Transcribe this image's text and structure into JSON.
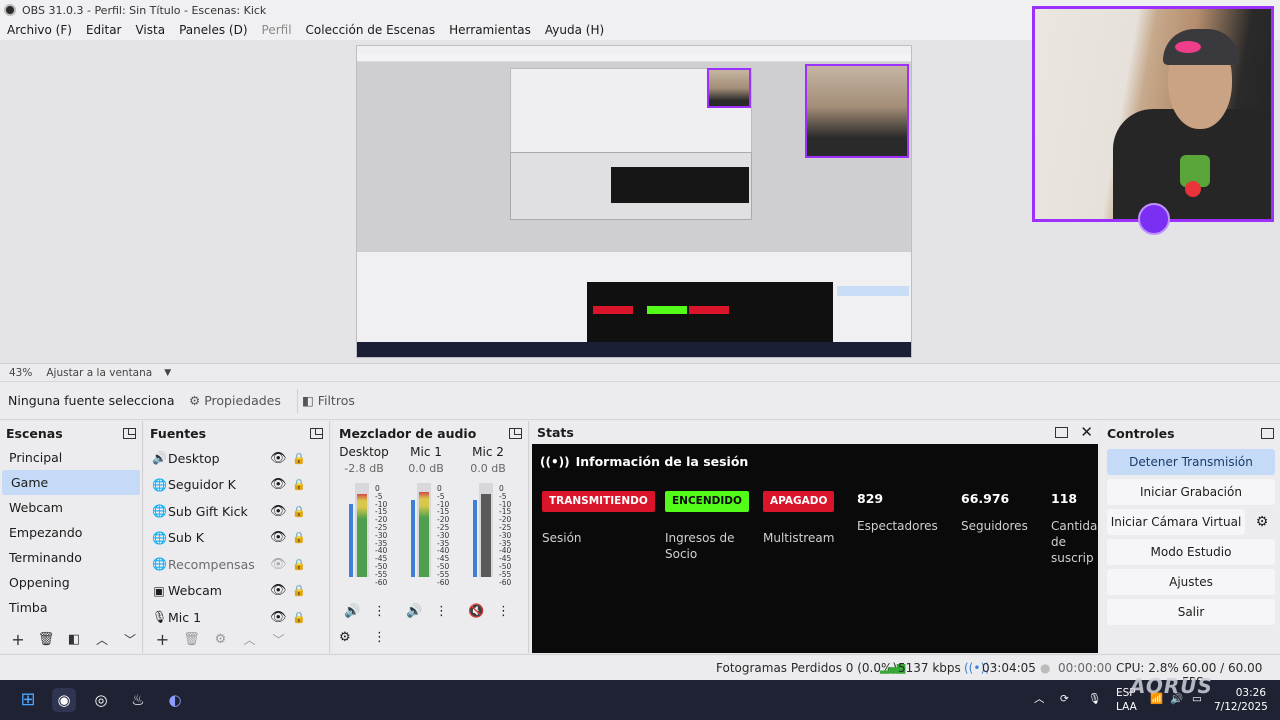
{
  "window": {
    "title": "OBS 31.0.3 - Perfil: Sin Título - Escenas: Kick"
  },
  "menu": [
    {
      "label": "Archivo (F)",
      "enabled": true
    },
    {
      "label": "Editar",
      "enabled": true
    },
    {
      "label": "Vista",
      "enabled": true
    },
    {
      "label": "Paneles (D)",
      "enabled": true
    },
    {
      "label": "Perfil",
      "enabled": false
    },
    {
      "label": "Colección de Escenas",
      "enabled": true
    },
    {
      "label": "Herramientas",
      "enabled": true
    },
    {
      "label": "Ayuda (H)",
      "enabled": true
    }
  ],
  "preview": {
    "zoom": "43%",
    "scale_mode": "Ajustar a la ventana"
  },
  "props_bar": {
    "no_source": "Ninguna fuente selecciona",
    "properties": "Propiedades",
    "filters": "Filtros"
  },
  "scenes": {
    "title": "Escenas",
    "items": [
      "Principal",
      "Game",
      "Webcam",
      "Empezando",
      "Terminando",
      "Oppening",
      "Timba"
    ],
    "selected": "Game"
  },
  "sources": {
    "title": "Fuentes",
    "items": [
      {
        "name": "Desktop",
        "icon": "speaker-icon",
        "visible": true,
        "locked": false
      },
      {
        "name": "Seguidor K",
        "icon": "globe-icon",
        "visible": true,
        "locked": true
      },
      {
        "name": "Sub Gift Kick",
        "icon": "globe-icon",
        "visible": true,
        "locked": true
      },
      {
        "name": "Sub K",
        "icon": "globe-icon",
        "visible": true,
        "locked": true
      },
      {
        "name": "Recompensas",
        "icon": "globe-icon",
        "visible": false,
        "locked": true
      },
      {
        "name": "Webcam",
        "icon": "camera-icon",
        "visible": true,
        "locked": true
      },
      {
        "name": "Mic 1",
        "icon": "microphone-icon",
        "visible": true,
        "locked": true
      }
    ]
  },
  "mixer": {
    "title": "Mezclador de audio",
    "channels": [
      {
        "name": "Desktop",
        "db": "-2.8 dB",
        "level": 0.88,
        "fader": 0.78,
        "muted": false
      },
      {
        "name": "Mic 1",
        "db": "0.0 dB",
        "level": 0.9,
        "fader": 0.82,
        "muted": false
      },
      {
        "name": "Mic 2",
        "db": "0.0 dB",
        "level": 0.88,
        "fader": 0.82,
        "muted": true
      }
    ],
    "scale": [
      "0",
      "-5",
      "-10",
      "-15",
      "-20",
      "-25",
      "-30",
      "-35",
      "-40",
      "-45",
      "-50",
      "-55",
      "-60"
    ]
  },
  "stats": {
    "title": "Stats",
    "session_title": "Información de la sesión",
    "badges": [
      {
        "text": "TRANSMITIENDO",
        "label": "Sesión",
        "color": "#d9142b",
        "text_color": "#ffffff"
      },
      {
        "text": "ENCENDIDO",
        "label": "Ingresos de Socio",
        "color": "#53fc18",
        "text_color": "#0a0a0a"
      },
      {
        "text": "APAGADO",
        "label": "Multistream",
        "color": "#d9142b",
        "text_color": "#ffffff"
      }
    ],
    "numbers": [
      {
        "value": "829",
        "label": "Espectadores"
      },
      {
        "value": "66.976",
        "label": "Seguidores"
      },
      {
        "value": "118",
        "label": "Cantidad de suscrip"
      }
    ]
  },
  "controls": {
    "title": "Controles",
    "buttons": [
      "Detener Transmisión",
      "Iniciar Grabación",
      "Iniciar Cámara Virtual",
      "Modo Estudio",
      "Ajustes",
      "Salir"
    ]
  },
  "status": {
    "dropped": "Fotogramas Perdidos 0 (0.0%)",
    "bitrate": "5137 kbps",
    "stream_time": "03:04:05",
    "rec_time": "00:00:00",
    "cpu": "CPU: 2.8%",
    "fps": "60.00 / 60.00 FPS"
  },
  "taskbar": {
    "lang1": "ESP",
    "lang2": "LAA",
    "time": "03:26",
    "date": "7/12/2025",
    "brand": "AORUS"
  },
  "accent": {
    "kick_green": "#53fc18",
    "live_red": "#d9142b",
    "purple": "#9b30ff",
    "select_blue": "#c4daf6"
  }
}
